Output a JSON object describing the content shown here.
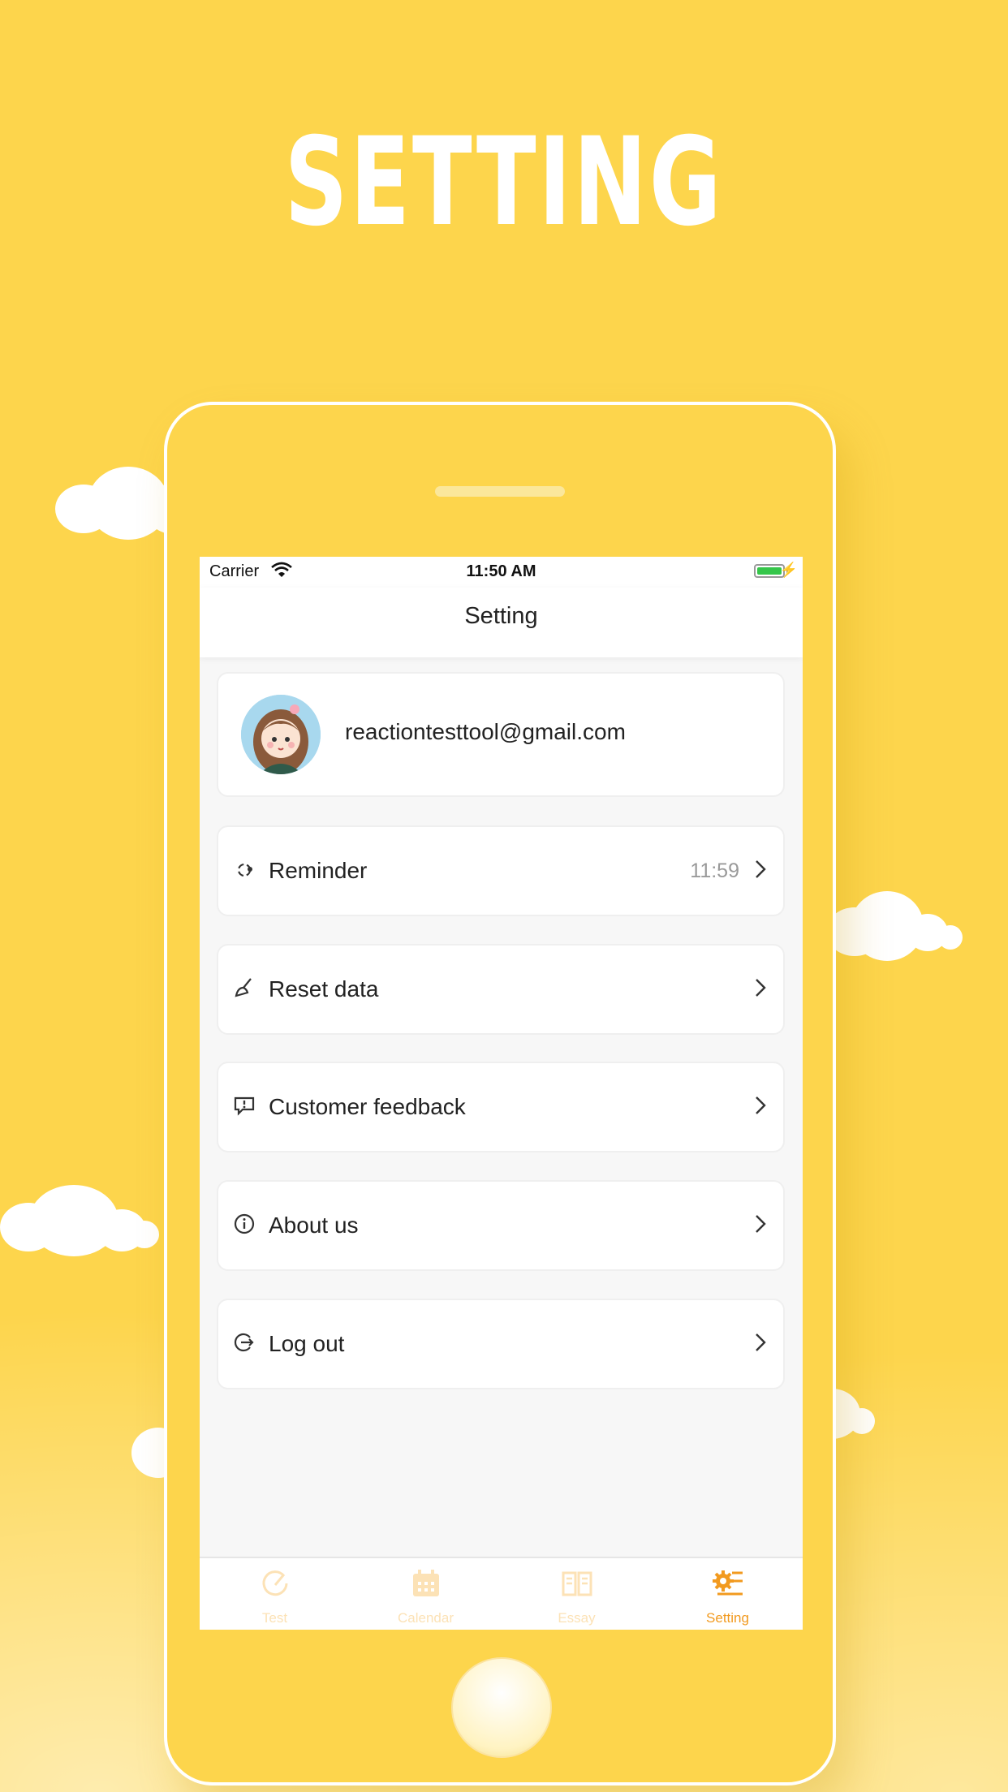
{
  "hero": {
    "title": "SETTING"
  },
  "status_bar": {
    "carrier": "Carrier",
    "time": "11:50 AM"
  },
  "nav": {
    "title": "Setting"
  },
  "profile": {
    "email": "reactiontesttool@gmail.com"
  },
  "menu": [
    {
      "label": "Reminder",
      "value": "11:59",
      "icon": "reminder-icon"
    },
    {
      "label": "Reset data",
      "icon": "broom-icon"
    },
    {
      "label": "Customer feedback",
      "icon": "feedback-icon"
    },
    {
      "label": "About us",
      "icon": "info-icon"
    },
    {
      "label": "Log out",
      "icon": "logout-icon"
    }
  ],
  "tabs": [
    {
      "label": "Test",
      "icon": "gauge-icon",
      "active": false
    },
    {
      "label": "Calendar",
      "icon": "calendar-icon",
      "active": false
    },
    {
      "label": "Essay",
      "icon": "book-icon",
      "active": false
    },
    {
      "label": "Setting",
      "icon": "settings-icon",
      "active": true
    }
  ],
  "colors": {
    "background": "#FDD54C",
    "accent": "#F29A1F",
    "tab_inactive": "#FCE2B6"
  }
}
